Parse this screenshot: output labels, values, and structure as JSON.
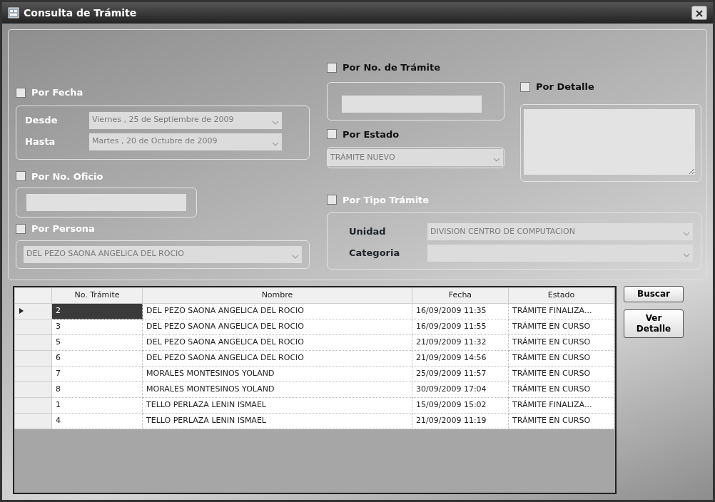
{
  "window": {
    "title": "Consulta de Trámite"
  },
  "por_fecha": {
    "label": "Por Fecha",
    "checked": false,
    "desde_label": "Desde",
    "desde_value": "Viernes , 25 de Septiembre de 2009",
    "hasta_label": "Hasta",
    "hasta_value": "Martes , 20 de Octubre de 2009"
  },
  "por_oficio": {
    "label": "Por No. Oficio",
    "checked": false
  },
  "por_persona": {
    "label": "Por Persona",
    "checked": false,
    "value": "DEL PEZO SAONA ANGELICA DEL ROCIO"
  },
  "por_tramite": {
    "label": "Por No. de Trámite",
    "checked": false
  },
  "por_estado": {
    "label": "Por Estado",
    "checked": false,
    "value": "TRÁMITE NUEVO"
  },
  "por_detalle": {
    "label": "Por Detalle",
    "checked": false
  },
  "por_tipo": {
    "label": "Por Tipo Trámite",
    "checked": false,
    "unidad_label": "Unidad",
    "unidad_value": "DIVISION CENTRO DE COMPUTACION",
    "categoria_label": "Categoria"
  },
  "table": {
    "columns": [
      "No. Trámite",
      "Nombre",
      "Fecha",
      "Estado"
    ],
    "rows": [
      {
        "cells": [
          "2",
          "DEL PEZO SAONA ANGELICA DEL ROCIO",
          "16/09/2009 11:35",
          "TRÁMITE FINALIZA..."
        ],
        "selected": true
      },
      {
        "cells": [
          "3",
          "DEL PEZO SAONA ANGELICA DEL ROCIO",
          "16/09/2009 11:55",
          "TRÁMITE EN CURSO"
        ],
        "selected": false
      },
      {
        "cells": [
          "5",
          "DEL PEZO SAONA ANGELICA DEL ROCIO",
          "21/09/2009 11:32",
          "TRÁMITE EN CURSO"
        ],
        "selected": false
      },
      {
        "cells": [
          "6",
          "DEL PEZO SAONA ANGELICA DEL ROCIO",
          "21/09/2009 14:56",
          "TRÁMITE EN CURSO"
        ],
        "selected": false
      },
      {
        "cells": [
          "7",
          "MORALES MONTESINOS YOLAND",
          "25/09/2009 11:57",
          "TRÁMITE EN CURSO"
        ],
        "selected": false
      },
      {
        "cells": [
          "8",
          "MORALES MONTESINOS YOLAND",
          "30/09/2009 17:04",
          "TRÁMITE EN CURSO"
        ],
        "selected": false
      },
      {
        "cells": [
          "1",
          "TELLO PERLAZA LENIN ISMAEL",
          "15/09/2009 15:02",
          "TRÁMITE FINALIZA..."
        ],
        "selected": false
      },
      {
        "cells": [
          "4",
          "TELLO PERLAZA LENIN ISMAEL",
          "21/09/2009 11:19",
          "TRÁMITE EN CURSO"
        ],
        "selected": false
      }
    ]
  },
  "buttons": [
    "Buscar",
    "Ver Detalle"
  ]
}
